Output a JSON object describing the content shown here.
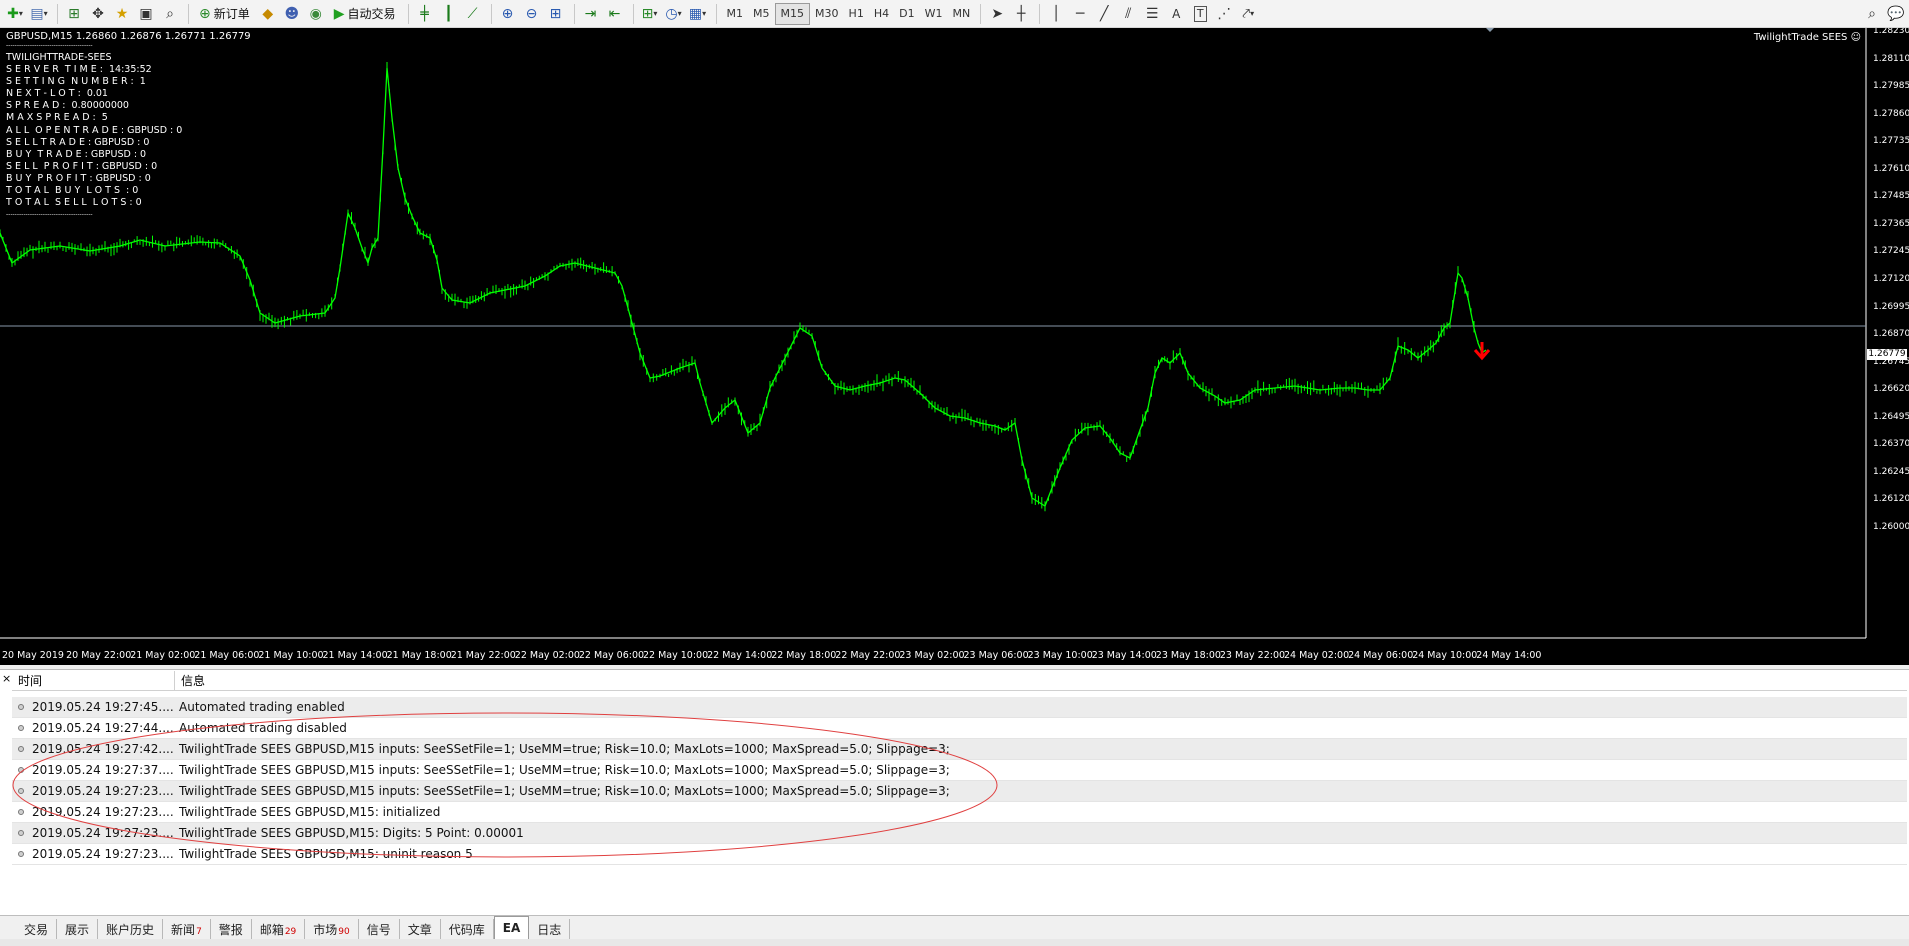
{
  "toolbar": {
    "new_order_label": "新订单",
    "auto_trade_label": "自动交易",
    "timeframes": [
      "M1",
      "M5",
      "M15",
      "M30",
      "H1",
      "H4",
      "D1",
      "W1",
      "MN"
    ]
  },
  "chart": {
    "header": "GBPUSD,M15  1.26860 1.26876 1.26771 1.26779",
    "ea_name": "TwilightTrade SEES ☺",
    "current_price": "1.26779",
    "info_lines": [
      "----------------------------------------",
      "TWILIGHTTRADE-SEES",
      "S E R V E R  T I M E :  14:35:52",
      "S E T T I N G  N U M B E R :  1",
      "N E X T - L O T :  0.01",
      "S P R E A D :  0.80000000",
      "M A X S P R E A D :  5",
      "A L L  O P E N T R A D E : GBPUSD : 0",
      "S E L L T R A D E : GBPUSD : 0",
      "B U Y  T R A D E : GBPUSD : 0",
      "S E L L  P R O F I T : GBPUSD : 0",
      "B U Y  P R O F I T : GBPUSD : 0",
      "T O T A L  B U Y  L O T S  : 0",
      "T O T A L  S E L L  L O T S : 0",
      "----------------------------------------"
    ],
    "price_axis": [
      "1.28230",
      "1.28110",
      "1.27985",
      "1.27860",
      "1.27735",
      "1.27610",
      "1.27485",
      "1.27365",
      "1.27245",
      "1.27120",
      "1.26995",
      "1.26870",
      "1.26745",
      "1.26620",
      "1.26495",
      "1.26370",
      "1.26245",
      "1.26120",
      "1.26000"
    ],
    "time_axis": [
      "20 May 2019",
      "20 May 22:00",
      "21 May 02:00",
      "21 May 06:00",
      "21 May 10:00",
      "21 May 14:00",
      "21 May 18:00",
      "21 May 22:00",
      "22 May 02:00",
      "22 May 06:00",
      "22 May 10:00",
      "22 May 14:00",
      "22 May 18:00",
      "22 May 22:00",
      "23 May 02:00",
      "23 May 06:00",
      "23 May 10:00",
      "23 May 14:00",
      "23 May 18:00",
      "23 May 22:00",
      "24 May 02:00",
      "24 May 06:00",
      "24 May 10:00",
      "24 May 14:00"
    ],
    "line_color": "#00ff00",
    "arrow_color": "#ff0000"
  },
  "terminal": {
    "close": "×",
    "col_time": "时间",
    "col_msg": "信息",
    "rows": [
      {
        "time": "2019.05.24 19:27:45....",
        "msg": "Automated trading enabled"
      },
      {
        "time": "2019.05.24 19:27:44....",
        "msg": "Automated trading disabled"
      },
      {
        "time": "2019.05.24 19:27:42....",
        "msg": "TwilightTrade SEES GBPUSD,M15 inputs: SeeSSetFile=1; UseMM=true; Risk=10.0; MaxLots=1000; MaxSpread=5.0; Slippage=3;"
      },
      {
        "time": "2019.05.24 19:27:37....",
        "msg": "TwilightTrade SEES GBPUSD,M15 inputs: SeeSSetFile=1; UseMM=true; Risk=10.0; MaxLots=1000; MaxSpread=5.0; Slippage=3;"
      },
      {
        "time": "2019.05.24 19:27:23....",
        "msg": "TwilightTrade SEES GBPUSD,M15 inputs: SeeSSetFile=1; UseMM=true; Risk=10.0; MaxLots=1000; MaxSpread=5.0; Slippage=3;"
      },
      {
        "time": "2019.05.24 19:27:23....",
        "msg": "TwilightTrade SEES GBPUSD,M15: initialized"
      },
      {
        "time": "2019.05.24 19:27:23....",
        "msg": "TwilightTrade SEES GBPUSD,M15: Digits: 5 Point: 0.00001"
      },
      {
        "time": "2019.05.24 19:27:23....",
        "msg": "TwilightTrade SEES GBPUSD,M15: uninit reason 5"
      }
    ]
  },
  "tabs": [
    {
      "label": "交易",
      "badge": ""
    },
    {
      "label": "展示",
      "badge": ""
    },
    {
      "label": "账户历史",
      "badge": ""
    },
    {
      "label": "新闻",
      "badge": "7"
    },
    {
      "label": "警报",
      "badge": ""
    },
    {
      "label": "邮箱",
      "badge": "29"
    },
    {
      "label": "市场",
      "badge": "90"
    },
    {
      "label": "信号",
      "badge": ""
    },
    {
      "label": "文章",
      "badge": ""
    },
    {
      "label": "代码库",
      "badge": ""
    },
    {
      "label": "EA",
      "badge": "",
      "active": true
    },
    {
      "label": "日志",
      "badge": ""
    }
  ]
}
